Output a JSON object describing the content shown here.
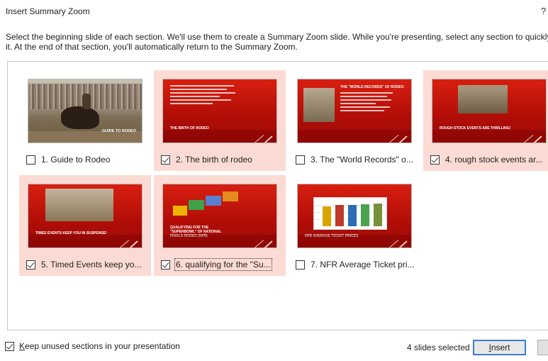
{
  "dialog": {
    "title": "Insert Summary Zoom",
    "help": "?"
  },
  "instructions": {
    "line1": "Select the beginning slide of each section. We'll use them to create a Summary Zoom slide. While you're presenting, select any section to quickly jump to",
    "line2": "it. At the end of that section, you'll automatically return to the Summary Zoom."
  },
  "slides": [
    {
      "label": "1. Guide to Rodeo",
      "checked": false,
      "selected": false,
      "thumb_caption": "GUIDE TO RODEO"
    },
    {
      "label": "2. The birth of rodeo",
      "checked": true,
      "selected": true,
      "thumb_caption": "THE BIRTH OF RODEO"
    },
    {
      "label": "3. The \"World Records\" o...",
      "checked": false,
      "selected": false,
      "thumb_caption": "THE \"WORLD RECORDS\" OF RODEO"
    },
    {
      "label": "4. rough stock events ar...",
      "checked": true,
      "selected": true,
      "thumb_caption": "ROUGH STOCK EVENTS ARE THRILLING!"
    },
    {
      "label": "5. Timed Events keep yo...",
      "checked": true,
      "selected": true,
      "thumb_caption": "TIMED EVENTS KEEP YOU IN SUSPENSE!"
    },
    {
      "label": "6. qualifying for the \"Su...",
      "checked": true,
      "selected": true,
      "thumb_caption": "QUALIFYING FOR THE \"SUPERBOWL\" OF NATIONAL FINALS RODEO (NFR)"
    },
    {
      "label": "7. NFR Average Ticket pri...",
      "checked": false,
      "selected": false,
      "thumb_caption": "NFR AVERAGE TICKET PRICES"
    }
  ],
  "footer": {
    "keep_label_accel": "K",
    "keep_label_rest": "eep unused sections in your presentation",
    "keep_checked": true,
    "status": "4 slides selected",
    "insert_accel": "I",
    "insert_rest": "nsert"
  },
  "colors": {
    "selected_tile": "#fbdbd3",
    "slide_red": "#c8170c",
    "default_button_border": "#3b7bd6"
  }
}
